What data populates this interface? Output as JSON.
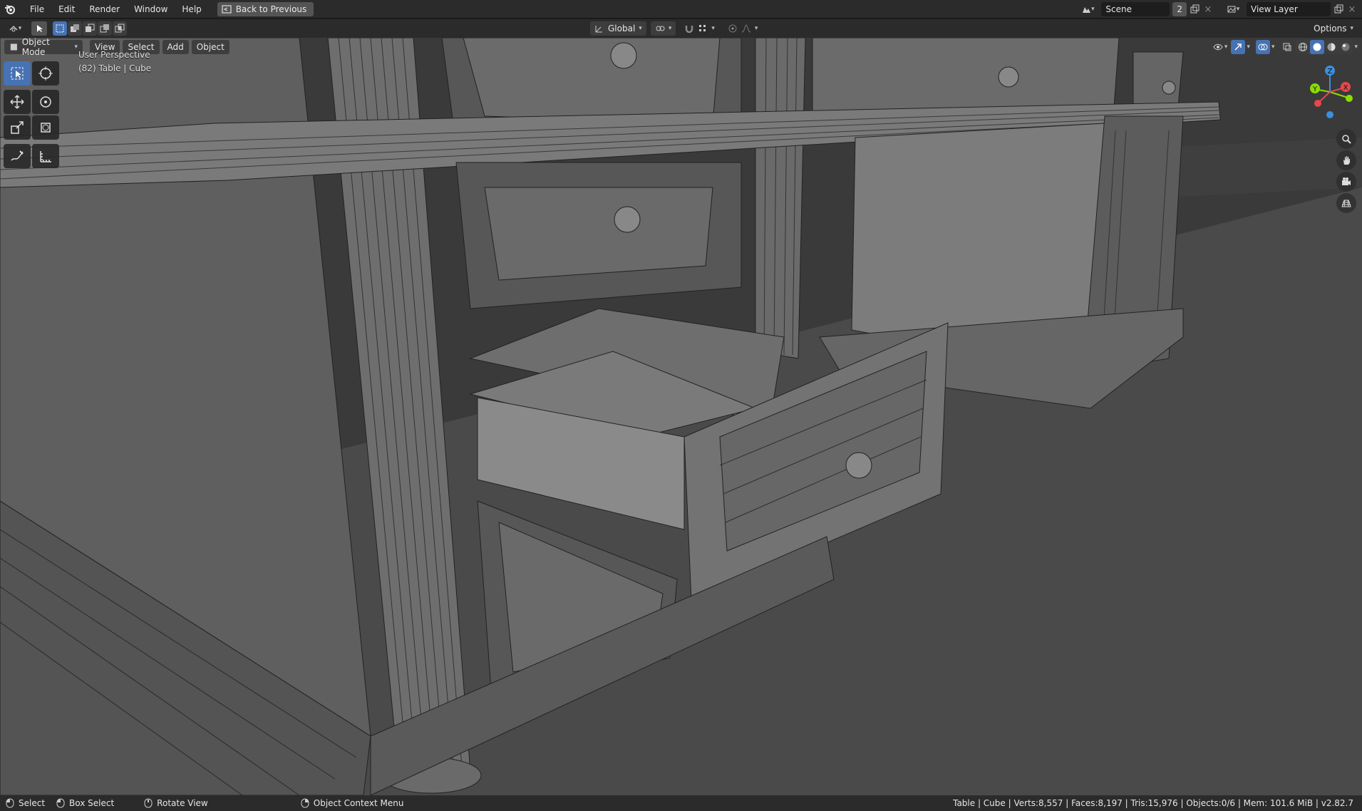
{
  "topbar": {
    "menus": [
      "File",
      "Edit",
      "Render",
      "Window",
      "Help"
    ],
    "back_button": "Back to Previous",
    "scene_name": "Scene",
    "scene_users": "2",
    "view_layer": "View Layer"
  },
  "headerbar": {
    "transform_orientation": "Global",
    "options_label": "Options"
  },
  "viewport": {
    "mode": "Object Mode",
    "menus": [
      "View",
      "Select",
      "Add",
      "Object"
    ],
    "perspective_label": "User Perspective",
    "object_label": "(82) Table | Cube",
    "gizmo_axes": {
      "x": "X",
      "y": "Y",
      "z": "Z"
    },
    "colors": {
      "x_axis": "#e5484d",
      "y_axis": "#8bdc00",
      "z_axis": "#3b8fde",
      "active": "#4772b3"
    }
  },
  "tools": [
    "select-box",
    "cursor",
    "move",
    "rotate",
    "scale",
    "transform",
    "annotate",
    "measure"
  ],
  "statusbar": {
    "select": "Select",
    "box_select": "Box Select",
    "rotate_view": "Rotate View",
    "context_menu": "Object Context Menu",
    "stats": "Table | Cube | Verts:8,557 | Faces:8,197 | Tris:15,976 | Objects:0/6 | Mem: 101.6 MiB | v2.82.7"
  }
}
